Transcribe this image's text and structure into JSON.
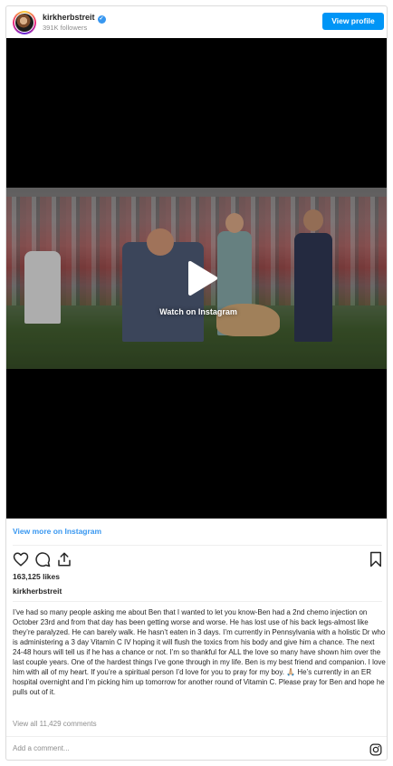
{
  "header": {
    "username": "kirkherbstreit",
    "verified_icon": "verified-badge-icon",
    "followers": "391K followers",
    "view_profile_label": "View profile"
  },
  "video": {
    "watch_label": "Watch on Instagram",
    "play_icon": "play-icon"
  },
  "view_more_label": "View more on Instagram",
  "actions": {
    "icons": [
      "heart-icon",
      "comment-icon",
      "share-icon",
      "bookmark-icon"
    ]
  },
  "likes": "163,125 likes",
  "caption": {
    "username": "kirkherbstreit",
    "text": "I’ve had so many people asking me about Ben that I wanted to let you know-Ben had a 2nd chemo injection on October 23rd and from that day has been getting worse and worse. He has lost use of his back legs-almost like they’re paralyzed. He can barely walk. He hasn’t eaten in 3 days. I’m currently in Pennsylvania with a holistic Dr who is administering a 3 day Vitamin C IV hoping it will flush the toxics from his body and give him a chance. The next 24-48 hours will tell us if he has a chance or not. I’m so thankful for ALL the love so many have shown him over the last couple years. One of the hardest things I’ve gone through in my life. Ben is my best friend and companion. I love him with all of my heart. If you’re a spiritual person I’d love for you to pray for my boy. 🙏🏼 He’s currently in an ER hospital overnight and I’m picking him up tomorrow for another round of Vitamin C. Please pray for Ben and hope he pulls out of it."
  },
  "view_comments": "View all 11,429 comments",
  "comment_placeholder": "Add a comment...",
  "colors": {
    "accent": "#0095f6",
    "link": "#3897f0",
    "muted": "#8e8e8e",
    "text": "#262626",
    "border": "#dbdbdb"
  }
}
